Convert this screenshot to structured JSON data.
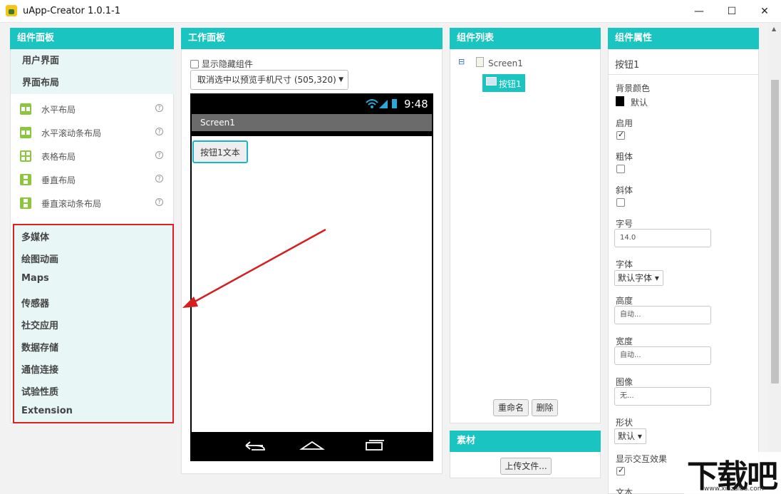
{
  "window": {
    "title": "uApp-Creator 1.0.1-1",
    "minimize": "—",
    "maximize": "☐",
    "close": "✕"
  },
  "palette": {
    "header": "组件面板",
    "categories_top": [
      "用户界面",
      "界面布局"
    ],
    "items": [
      {
        "label": "水平布局",
        "icon": "horizontal-layout-icon"
      },
      {
        "label": "水平滚动条布局",
        "icon": "horizontal-scroll-layout-icon"
      },
      {
        "label": "表格布局",
        "icon": "table-layout-icon"
      },
      {
        "label": "垂直布局",
        "icon": "vertical-layout-icon"
      },
      {
        "label": "垂直滚动条布局",
        "icon": "vertical-scroll-layout-icon"
      }
    ],
    "help": "?",
    "categories_bottom": [
      "多媒体",
      "绘图动画",
      "Maps",
      "传感器",
      "社交应用",
      "数据存储",
      "通信连接",
      "试验性质",
      "Extension"
    ]
  },
  "viewer": {
    "header": "工作面板",
    "show_hidden_label": "显示隐藏组件",
    "preview_select": "取消选中以预览手机尺寸 (505,320)",
    "status_time": "9:48",
    "screen_title": "Screen1",
    "button_text": "按钮1文本"
  },
  "components": {
    "header": "组件列表",
    "tree_toggle": "⊟",
    "root": "Screen1",
    "child": "按钮1",
    "rename": "重命名",
    "delete": "删除"
  },
  "media": {
    "header": "素材",
    "upload": "上传文件..."
  },
  "properties": {
    "header": "组件属性",
    "component_name": "按钮1",
    "bg_color_label": "背景颜色",
    "bg_color_value": "默认",
    "enabled_label": "启用",
    "bold_label": "粗体",
    "italic_label": "斜体",
    "font_size_label": "字号",
    "font_size_value": "14.0",
    "font_label": "字体",
    "font_value": "默认字体 ▾",
    "height_label": "高度",
    "height_value": "自动...",
    "width_label": "宽度",
    "width_value": "自动...",
    "image_label": "图像",
    "image_value": "无...",
    "shape_label": "形状",
    "shape_value": "默认 ▾",
    "feedback_label": "显示交互效果",
    "text_label": "文本"
  },
  "watermark": {
    "big": "下载吧",
    "url": "www.xiazaiba.com"
  },
  "colors": {
    "accent": "#19c4c1",
    "highlight_box": "#e02020",
    "arrow": "#d42020"
  }
}
